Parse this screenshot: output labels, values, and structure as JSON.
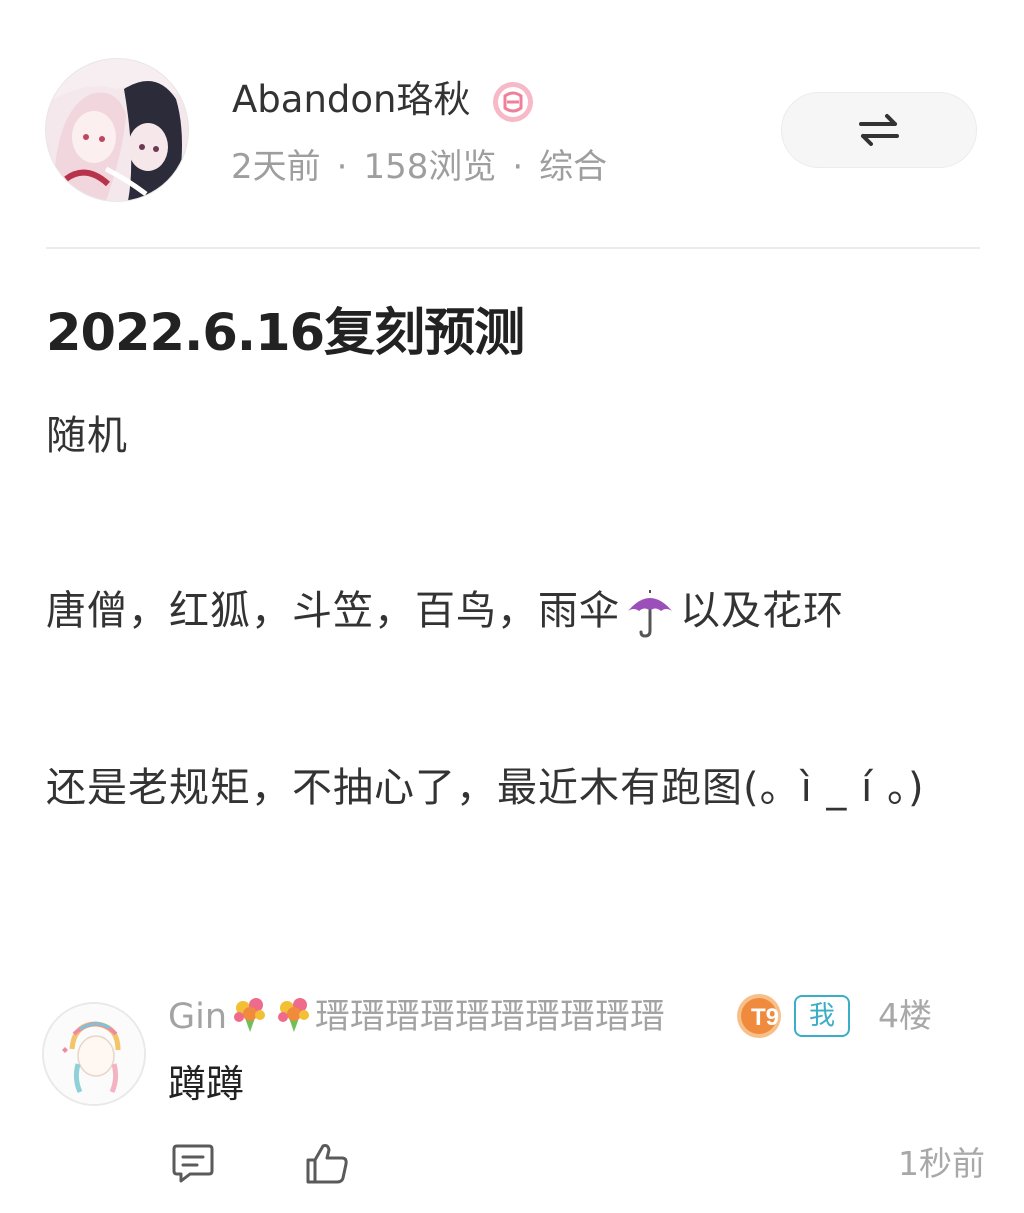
{
  "post": {
    "author": {
      "name": "Abandon珞秋",
      "badge_icon": "level-badge-icon"
    },
    "meta": {
      "time": "2天前",
      "views": "158浏览",
      "category": "综合",
      "separator": "·"
    },
    "switch_icon": "swap-arrows-icon",
    "title": "2022.6.16复刻预测",
    "paragraphs": {
      "p1": "随机",
      "p2_before": "唐僧，红狐，斗笠，百鸟，雨伞",
      "p2_emoji": "umbrella-icon",
      "p2_after": "以及花环",
      "p3": "还是老规矩，不抽心了，最近木有跑图(。ì _ í 。)"
    }
  },
  "comment": {
    "user": {
      "name_prefix": "Gin",
      "name_suffix": "瑨瑨瑨瑨瑨瑨瑨瑨瑨瑨",
      "emoji": "bouquet-icon"
    },
    "level_badge": "T9",
    "me_tag": "我",
    "floor": "4楼",
    "text": "蹲蹲",
    "time": "1秒前",
    "actions": [
      "reply-icon",
      "like-icon"
    ]
  },
  "colors": {
    "primary_text": "#222222",
    "secondary_text": "#9e9e9e",
    "badge_pink": "#f39bb0",
    "me_tag": "#3aaec6",
    "level_orange": "#f08a3c"
  }
}
